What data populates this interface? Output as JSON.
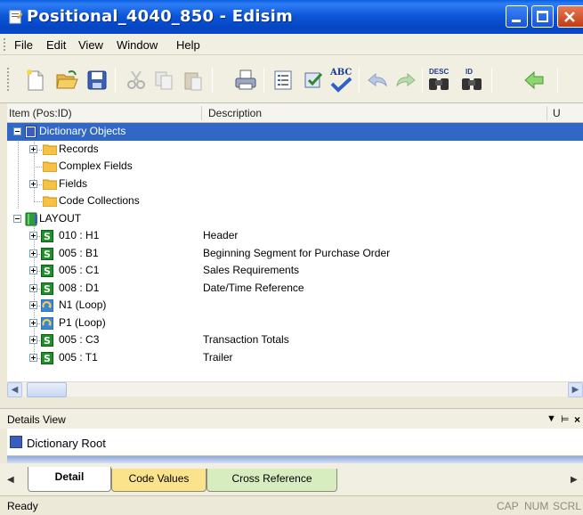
{
  "window": {
    "title": "Positional_4040_850 - Edisim"
  },
  "menu": [
    "File",
    "Edit",
    "View",
    "Window",
    "Help"
  ],
  "toolbar": {
    "buttons": [
      "new",
      "open",
      "save",
      "cut",
      "copy",
      "paste",
      "print",
      "properties",
      "validate",
      "spellcheck",
      "undo",
      "redo",
      "find-desc",
      "find-id",
      "back"
    ],
    "spell_label": "ABC",
    "desc_label": "DESC",
    "id_label": "ID"
  },
  "columns": {
    "item": "Item (Pos:ID)",
    "description": "Description",
    "u": "U"
  },
  "tree": {
    "root": "Dictionary Objects",
    "children": [
      "Records",
      "Complex Fields",
      "Fields",
      "Code Collections"
    ],
    "layout": "LAYOUT",
    "segments": [
      {
        "id": "010 : H1",
        "desc": "Header"
      },
      {
        "id": "005 : B1",
        "desc": "Beginning Segment for Purchase Order"
      },
      {
        "id": "005 : C1",
        "desc": "Sales Requirements"
      },
      {
        "id": "008 : D1",
        "desc": "Date/Time Reference"
      },
      {
        "id": "N1 (Loop)",
        "desc": ""
      },
      {
        "id": "P1 (Loop)",
        "desc": ""
      },
      {
        "id": "005 : C3",
        "desc": "Transaction Totals"
      },
      {
        "id": "005 : T1",
        "desc": "Trailer"
      }
    ],
    "segment_badge": "S"
  },
  "details": {
    "title": "Details View",
    "item": "Dictionary Root"
  },
  "tabs": [
    "Detail",
    "Code Values",
    "Cross Reference"
  ],
  "status": {
    "ready": "Ready",
    "cap": "CAP",
    "num": "NUM",
    "scrl": "SCRL"
  },
  "colors": {
    "titlebar": "#0a49c2",
    "selection": "#3167c5",
    "segment": "#1f8f2a",
    "tab_codes": "#fae38b",
    "tab_xref": "#d7ecbf"
  }
}
